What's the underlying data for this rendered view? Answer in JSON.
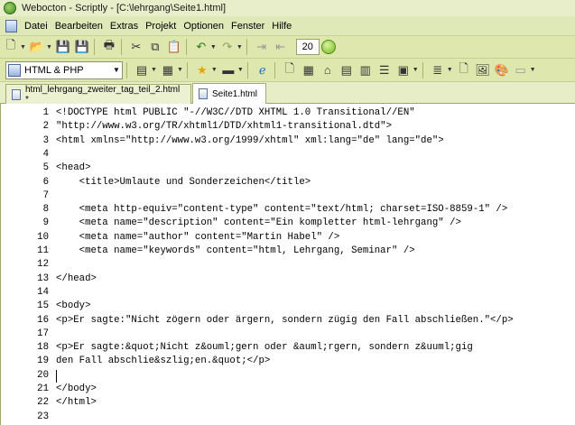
{
  "titlebar": {
    "title": "Webocton - Scriptly - [C:\\lehrgang\\Seite1.html]"
  },
  "menu": {
    "items": [
      "Datei",
      "Bearbeiten",
      "Extras",
      "Projekt",
      "Optionen",
      "Fenster",
      "Hilfe"
    ]
  },
  "toolbar": {
    "font_size": "20",
    "language": "HTML & PHP"
  },
  "tabs": [
    {
      "label": "html_lehrgang_zweiter_tag_teil_2.html *",
      "active": false
    },
    {
      "label": "Seite1.html",
      "active": true
    }
  ],
  "editor": {
    "lines": [
      {
        "n": "1",
        "t": "<!DOCTYPE html PUBLIC \"-//W3C//DTD XHTML 1.0 Transitional//EN\""
      },
      {
        "n": "2",
        "t": "\"http://www.w3.org/TR/xhtml1/DTD/xhtml1-transitional.dtd\">"
      },
      {
        "n": "3",
        "t": "<html xmlns=\"http://www.w3.org/1999/xhtml\" xml:lang=\"de\" lang=\"de\">"
      },
      {
        "n": "4",
        "t": ""
      },
      {
        "n": "5",
        "t": "<head>"
      },
      {
        "n": "6",
        "t": "    <title>Umlaute und Sonderzeichen</title>"
      },
      {
        "n": "7",
        "t": ""
      },
      {
        "n": "8",
        "t": "    <meta http-equiv=\"content-type\" content=\"text/html; charset=ISO-8859-1\" />"
      },
      {
        "n": "9",
        "t": "    <meta name=\"description\" content=\"Ein kompletter html-lehrgang\" />"
      },
      {
        "n": "10",
        "t": "    <meta name=\"author\" content=\"Martin Habel\" />"
      },
      {
        "n": "11",
        "t": "    <meta name=\"keywords\" content=\"html, Lehrgang, Seminar\" />"
      },
      {
        "n": "12",
        "t": ""
      },
      {
        "n": "13",
        "t": "</head>"
      },
      {
        "n": "14",
        "t": ""
      },
      {
        "n": "15",
        "t": "<body>"
      },
      {
        "n": "16",
        "t": "<p>Er sagte:\"Nicht zögern oder ärgern, sondern zügig den Fall abschließen.\"</p>"
      },
      {
        "n": "17",
        "t": ""
      },
      {
        "n": "18",
        "t": "<p>Er sagte:&quot;Nicht z&ouml;gern oder &auml;rgern, sondern z&uuml;gig"
      },
      {
        "n": "19",
        "t": "den Fall abschlie&szlig;en.&quot;</p>"
      },
      {
        "n": "20",
        "t": ""
      },
      {
        "n": "21",
        "t": "</body>"
      },
      {
        "n": "22",
        "t": "</html>"
      },
      {
        "n": "23",
        "t": ""
      }
    ]
  }
}
